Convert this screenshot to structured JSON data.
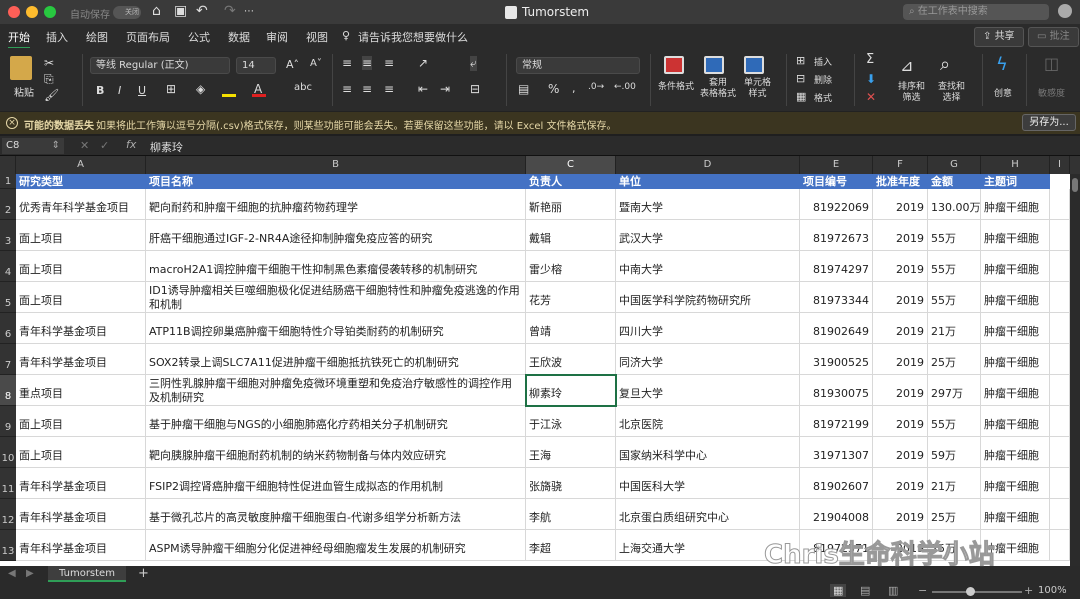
{
  "window": {
    "title": "Tumorstem",
    "autosave_label": "自动保存",
    "autosave_toggle": "关闭",
    "search_placeholder": "在工作表中搜索"
  },
  "menu": {
    "tabs": [
      "开始",
      "插入",
      "绘图",
      "页面布局",
      "公式",
      "数据",
      "审阅",
      "视图"
    ],
    "tell_me": "请告诉我您想要做什么",
    "share": "共享",
    "comment": "批注"
  },
  "ribbon": {
    "paste": "粘贴",
    "font_name": "等线 Regular (正文)",
    "font_size": "14",
    "number_format": "常规",
    "conditional_format": "条件格式",
    "format_as_table": "套用\n表格格式",
    "cell_styles": "单元格\n样式",
    "insert": "插入",
    "delete": "删除",
    "format": "格式",
    "sort_filter": "排序和\n筛选",
    "find_select": "查找和\n选择",
    "ideas": "创意",
    "sensitivity": "敏感度"
  },
  "warning": {
    "title": "可能的数据丢失",
    "message": "如果将此工作簿以逗号分隔(.csv)格式保存，则某些功能可能会丢失。若要保留这些功能，请以 Excel 文件格式保存。",
    "save_as": "另存为..."
  },
  "formula_bar": {
    "name_box": "C8",
    "fx": "fx",
    "value": "柳素玲"
  },
  "sheet": {
    "columns": [
      "A",
      "B",
      "C",
      "D",
      "E",
      "F",
      "G",
      "H",
      "I"
    ],
    "selected_column": "C",
    "selected_row": 8,
    "header": [
      "研究类型",
      "项目名称",
      "负责人",
      "单位",
      "项目编号",
      "批准年度",
      "金额",
      "主题词"
    ],
    "rows": [
      [
        "优秀青年科学基金项目",
        "靶向耐药和肿瘤干细胞的抗肿瘤药物药理学",
        "靳艳丽",
        "暨南大学",
        "81922069",
        "2019",
        "130.00万",
        "肿瘤干细胞"
      ],
      [
        "面上项目",
        "肝癌干细胞通过IGF-2-NR4A途径抑制肿瘤免疫应答的研究",
        "戴辑",
        "武汉大学",
        "81972673",
        "2019",
        "55万",
        "肿瘤干细胞"
      ],
      [
        "面上项目",
        "macroH2A1调控肿瘤干细胞干性抑制黑色素瘤侵袭转移的机制研究",
        "雷少榕",
        "中南大学",
        "81974297",
        "2019",
        "55万",
        "肿瘤干细胞"
      ],
      [
        "面上项目",
        "ID1诱导肿瘤相关巨噬细胞极化促进结肠癌干细胞特性和肿瘤免疫逃逸的作用和机制",
        "花芳",
        "中国医学科学院药物研究所",
        "81973344",
        "2019",
        "55万",
        "肿瘤干细胞"
      ],
      [
        "青年科学基金项目",
        "ATP11B调控卵巢癌肿瘤干细胞特性介导铂类耐药的机制研究",
        "曾靖",
        "四川大学",
        "81902649",
        "2019",
        "21万",
        "肿瘤干细胞"
      ],
      [
        "青年科学基金项目",
        "SOX2转录上调SLC7A11促进肿瘤干细胞抵抗铁死亡的机制研究",
        "王欣波",
        "同济大学",
        "31900525",
        "2019",
        "25万",
        "肿瘤干细胞"
      ],
      [
        "重点项目",
        "三阴性乳腺肿瘤干细胞对肿瘤免疫微环境重塑和免疫治疗敏感性的调控作用及机制研究",
        "柳素玲",
        "复旦大学",
        "81930075",
        "2019",
        "297万",
        "肿瘤干细胞"
      ],
      [
        "面上项目",
        "基于肿瘤干细胞与NGS的小细胞肺癌化疗药相关分子机制研究",
        "于江泳",
        "北京医院",
        "81972199",
        "2019",
        "55万",
        "肿瘤干细胞"
      ],
      [
        "面上项目",
        "靶向胰腺肿瘤干细胞耐药机制的纳米药物制备与体内效应研究",
        "王海",
        "国家纳米科学中心",
        "31971307",
        "2019",
        "59万",
        "肿瘤干细胞"
      ],
      [
        "青年科学基金项目",
        "FSIP2调控肾癌肿瘤干细胞特性促进血管生成拟态的作用机制",
        "张旖骁",
        "中国医科大学",
        "81902607",
        "2019",
        "21万",
        "肿瘤干细胞"
      ],
      [
        "青年科学基金项目",
        "基于微孔芯片的高灵敏度肿瘤干细胞蛋白-代谢多组学分析新方法",
        "李航",
        "北京蛋白质组研究中心",
        "21904008",
        "2019",
        "25万",
        "肿瘤干细胞"
      ],
      [
        "青年科学基金项目",
        "ASPM诱导肿瘤干细胞分化促进神经母细胞瘤发生发展的机制研究",
        "李超",
        "上海交通大学",
        "81972371",
        "2019",
        "25万",
        "肿瘤干细胞"
      ]
    ]
  },
  "sheet_tab": "Tumorstem",
  "watermark": "Chris生命科学小站",
  "status": {
    "zoom": "100%"
  },
  "colors": {
    "accent": "#2f9e57",
    "header_fill": "#4472c4"
  }
}
